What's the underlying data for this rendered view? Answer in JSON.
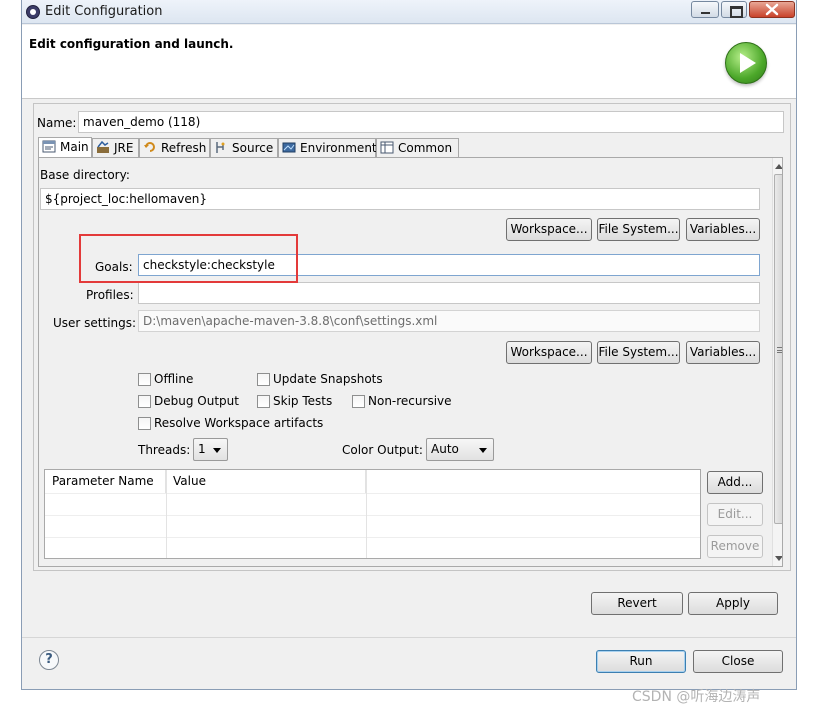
{
  "window": {
    "title": "Edit Configuration"
  },
  "header": {
    "title": "Edit configuration and launch."
  },
  "config": {
    "name_label": "Name:",
    "name_value": "maven_demo (118)"
  },
  "tabs": [
    {
      "label": "Main",
      "icon": "main-tab-icon"
    },
    {
      "label": "JRE",
      "icon": "jre-tab-icon"
    },
    {
      "label": "Refresh",
      "icon": "refresh-tab-icon"
    },
    {
      "label": "Source",
      "icon": "source-tab-icon"
    },
    {
      "label": "Environment",
      "icon": "environment-tab-icon"
    },
    {
      "label": "Common",
      "icon": "common-tab-icon"
    }
  ],
  "main": {
    "base_dir_label": "Base directory:",
    "base_dir_value": "${project_loc:hellomaven}",
    "workspace_label": "Workspace...",
    "filesystem_label": "File System...",
    "variables_label": "Variables...",
    "goals_label": "Goals:",
    "goals_value": "checkstyle:checkstyle",
    "profiles_label": "Profiles:",
    "profiles_value": "",
    "user_settings_label": "User settings:",
    "user_settings_value": "D:\\maven\\apache-maven-3.8.8\\conf\\settings.xml",
    "checkboxes": {
      "offline": "Offline",
      "update_snapshots": "Update Snapshots",
      "debug_output": "Debug Output",
      "skip_tests": "Skip Tests",
      "non_recursive": "Non-recursive",
      "resolve_workspace": "Resolve Workspace artifacts"
    },
    "threads_label": "Threads:",
    "threads_value": "1",
    "color_output_label": "Color Output:",
    "color_output_value": "Auto",
    "table": {
      "columns": [
        "Parameter Name",
        "Value"
      ]
    },
    "add_label": "Add...",
    "edit_label": "Edit...",
    "remove_label": "Remove"
  },
  "buttons": {
    "revert": "Revert",
    "apply": "Apply",
    "run": "Run",
    "close": "Close"
  },
  "help_glyph": "?",
  "watermark": "CSDN @听海边涛声",
  "colors": {
    "highlight": "#e33a3a",
    "launch_green": "#4ca82a"
  }
}
